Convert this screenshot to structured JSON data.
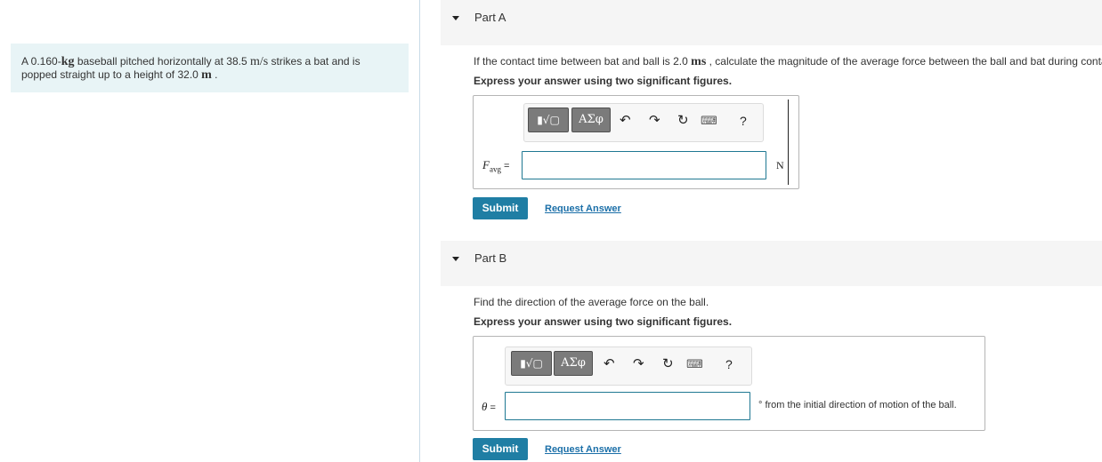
{
  "problem": {
    "text_1": "A 0.160-",
    "unit_kg": "kg",
    "text_2": " baseball pitched horizontally at 38.5 ",
    "unit_speed": "m/s",
    "text_3": " strikes a bat and is popped straight up to a height of 32.0 ",
    "unit_m": "m",
    "text_4": " ."
  },
  "part_a": {
    "title": "Part A",
    "prompt_1": "If the contact time between bat and ball is 2.0 ",
    "prompt_unit": "ms",
    "prompt_2": " , calculate the magnitude of the average force between the ball and bat during contact.",
    "instruction": "Express your answer using two significant figures.",
    "label_var": "F",
    "label_sub": "avg",
    "label_eq": " =",
    "input_value": "",
    "unit": "N",
    "submit_label": "Submit",
    "request_label": "Request Answer"
  },
  "part_b": {
    "title": "Part B",
    "prompt": "Find the direction of the average force on the ball.",
    "instruction": "Express your answer using two significant figures.",
    "label_var": "θ",
    "label_eq": " =",
    "input_value": "",
    "unit": "° from the initial direction of motion of the ball.",
    "submit_label": "Submit",
    "request_label": "Request Answer"
  },
  "toolbar": {
    "templates_label": "▮√▢",
    "greek_label": "ΑΣφ",
    "undo_icon": "↶",
    "redo_icon": "↷",
    "reset_icon": "↻",
    "keyboard_icon": "⌨",
    "help_label": "?"
  }
}
